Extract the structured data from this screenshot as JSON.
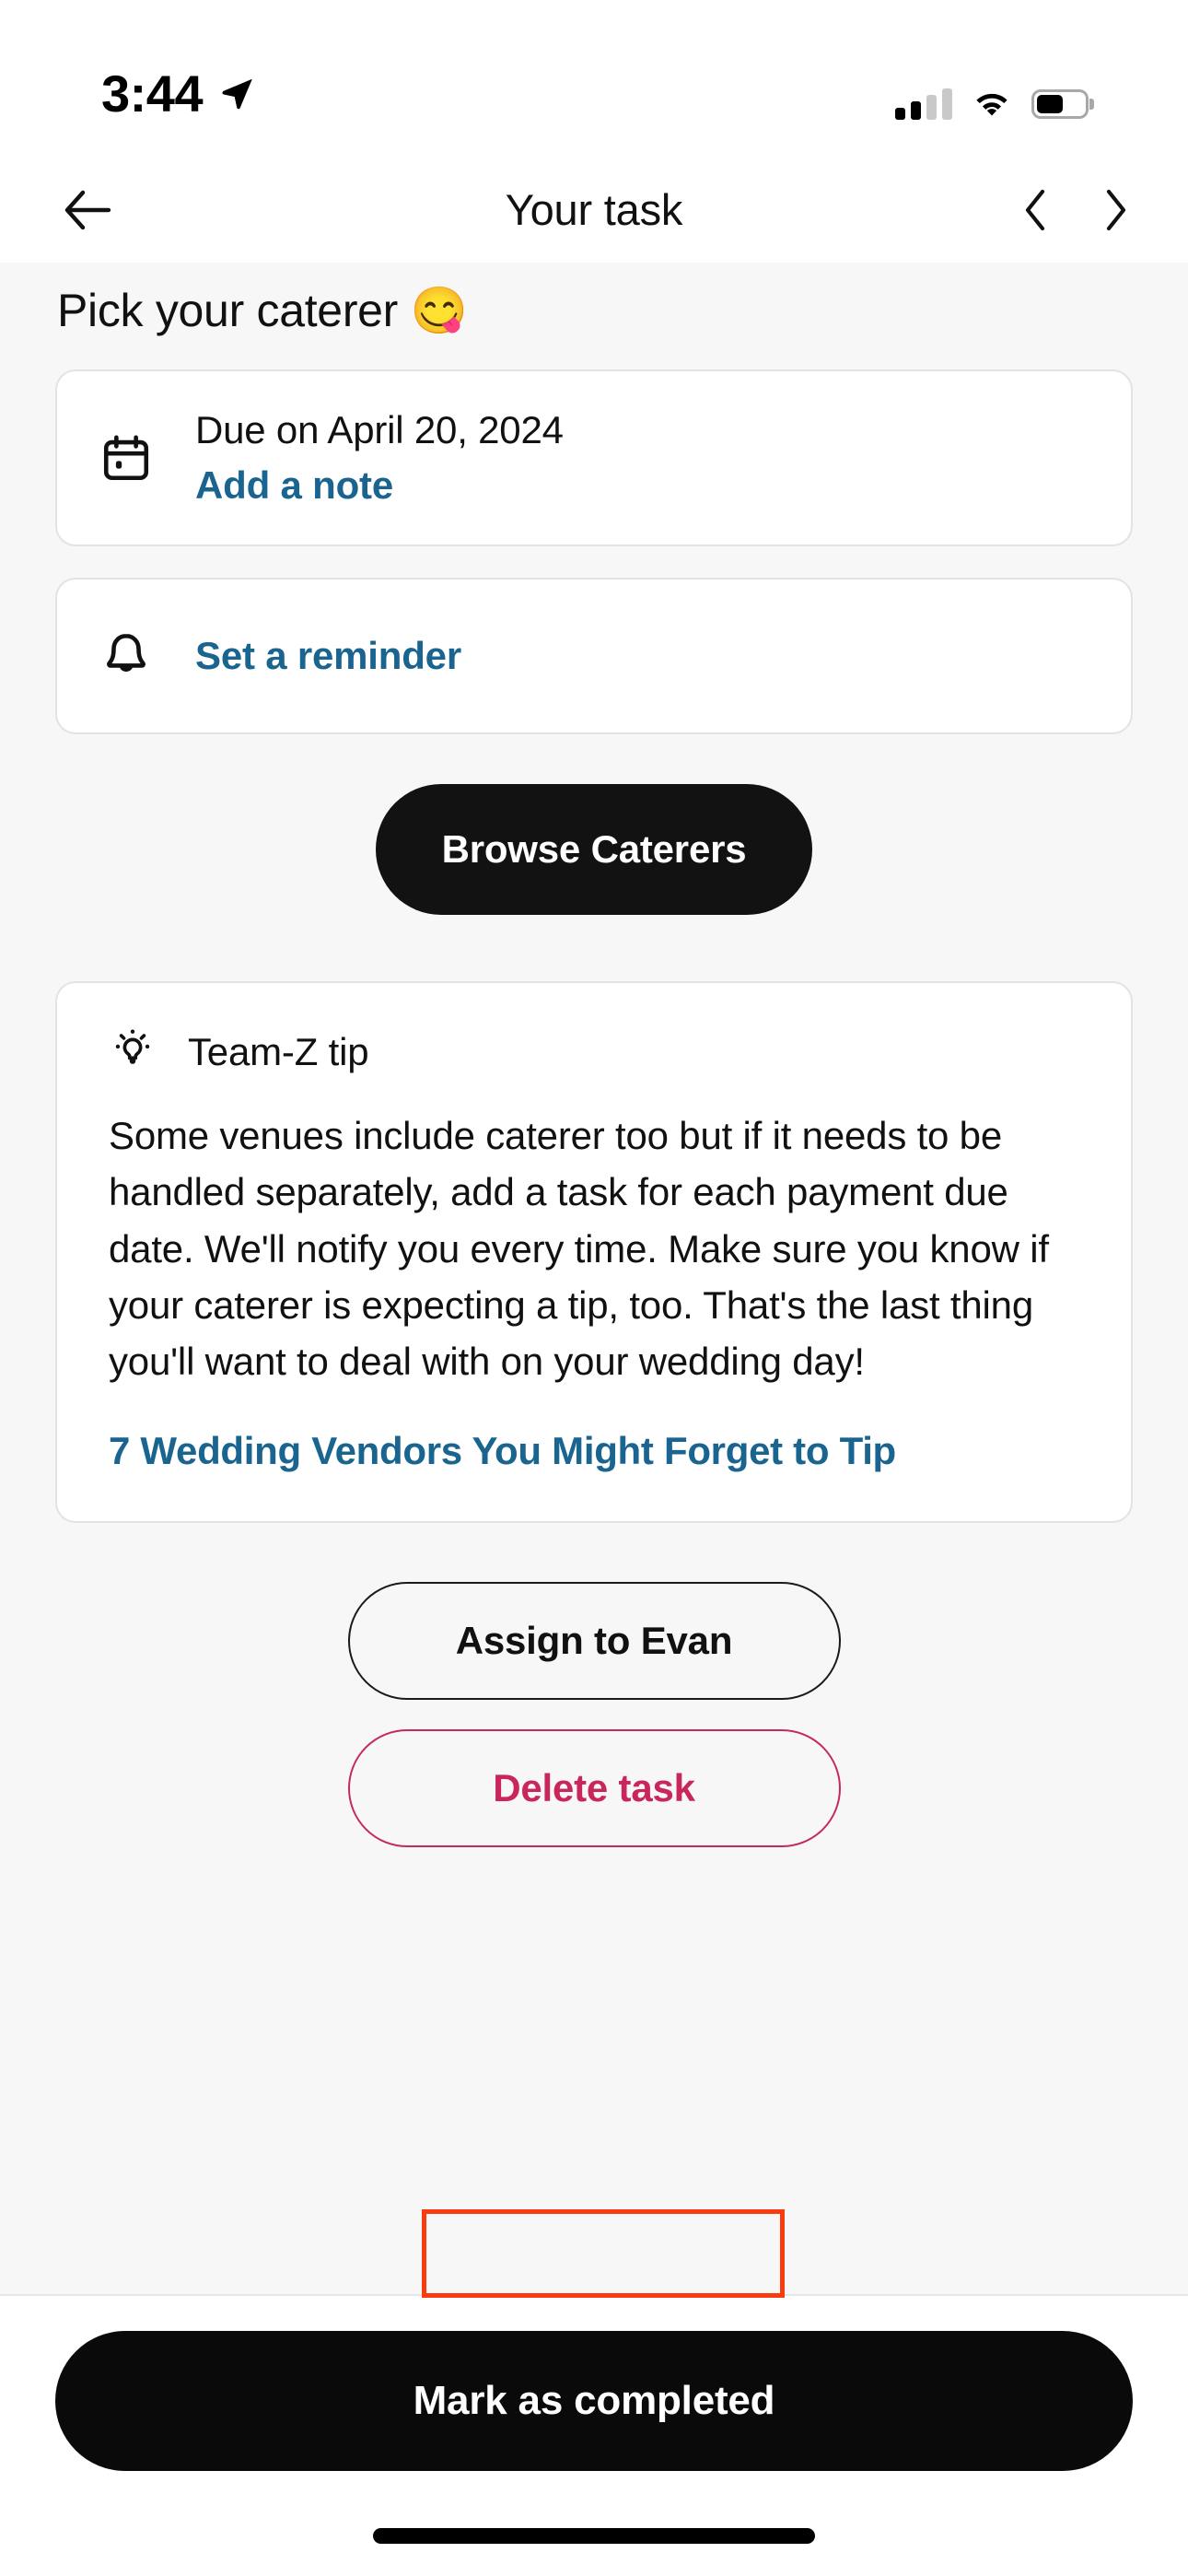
{
  "status_bar": {
    "time": "3:44",
    "location_icon": "location-arrow-icon",
    "signal_icon": "cellular-signal-icon",
    "signal_bars_filled": 2,
    "signal_bars_total": 4,
    "wifi_icon": "wifi-icon",
    "battery_icon": "battery-icon",
    "battery_percent": 55
  },
  "nav": {
    "back_icon": "arrow-left-icon",
    "title": "Your task",
    "prev_icon": "chevron-left-icon",
    "next_icon": "chevron-right-icon"
  },
  "task": {
    "title": "Pick your caterer 😋",
    "due_card": {
      "icon": "calendar-icon",
      "due_text": "Due on April 20, 2024",
      "note_link": "Add a note"
    },
    "reminder_card": {
      "icon": "bell-icon",
      "label": "Set a reminder"
    },
    "primary_cta": "Browse Caterers"
  },
  "tip": {
    "icon": "lightbulb-icon",
    "heading": "Team-Z tip",
    "body": "Some venues include caterer too but if it needs to be handled separately, add a task for each payment due date. We'll notify you every time. Make sure you know if your caterer is expecting a tip, too. That's the last thing you'll want to deal with on your wedding day!",
    "article_link": "7 Wedding Vendors You Might Forget to Tip"
  },
  "actions": {
    "assign": "Assign to Evan",
    "delete": "Delete task",
    "complete": "Mark as completed"
  },
  "colors": {
    "page_background": "#f7f7f7",
    "card_background": "#ffffff",
    "card_border": "#e3e3e3",
    "link_blue": "#1a6490",
    "danger": "#c9275c",
    "danger_border": "#c42a5e",
    "dark_button": "#121212",
    "annotation_highlight": "#f93b10"
  }
}
